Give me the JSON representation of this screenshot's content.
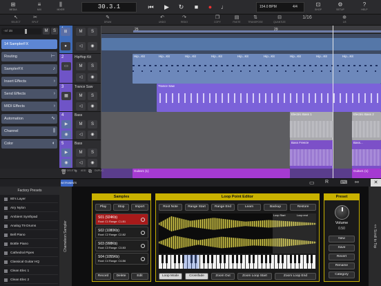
{
  "toolbar": {
    "media": "MEDIA",
    "mix": "MIX",
    "edit": "EDIT",
    "mixer": "MIXER",
    "position": "30.3.1",
    "bpm": "154.0 BPM",
    "sig": "4/4",
    "shop": "SHOP",
    "setup": "SETUP",
    "help": "HELP"
  },
  "subtoolbar": {
    "select": "SELECT",
    "split": "SPLIT",
    "draw": "DRAW",
    "undo": "UNDO",
    "redo": "REDO",
    "copy": "COPY",
    "paste": "PASTE",
    "quantize": "QUANTIZE",
    "transpose": "TRANSPOSE",
    "edit": "EDIT",
    "snap": "1/16",
    "zoom": "1/8"
  },
  "inspector": {
    "dryfx": "-Inf dB",
    "mute": "M",
    "solo": "S",
    "track": "14 SamplerFX",
    "items": [
      "Routing",
      "SamplerFX",
      "Insert Effects",
      "Send Effects",
      "MIDI Effects",
      "Automation",
      "Channel",
      "Color"
    ]
  },
  "ruler": [
    "25",
    "",
    "",
    "29",
    "",
    ""
  ],
  "tracks": [
    {
      "num": "1",
      "name": "",
      "color": "#6f54c7"
    },
    {
      "num": "2",
      "name": "HipHop Kit",
      "color": "#6f54c7"
    },
    {
      "num": "3",
      "name": "Trance Saw",
      "color": "#6f54c7"
    },
    {
      "num": "4",
      "name": "Bass",
      "color": "#6f54c7"
    },
    {
      "num": "5",
      "name": "Bass",
      "color": "#6f54c7"
    }
  ],
  "clips": {
    "hiphop": "Hip...Kit",
    "trance": "Trance Saw",
    "eb1": "Electric Bass 1",
    "eb2": "Electric Bass 2",
    "bf": "Bass Freeze",
    "bf2": "Bass...",
    "gt1": "Guitar1 (1)",
    "gt2": "Guitar1 (1)"
  },
  "bottomtools": {
    "delete": "DELETE",
    "add": "ADD",
    "duplicate": "DUPLIC."
  },
  "dock": {
    "instruments": "INSTRUMENTS"
  },
  "factory": {
    "title": "Factory Presets",
    "items": [
      "80's Layer",
      "Airy Nylon",
      "Ambient Synthpad",
      "Analog T9 Drums",
      "Bell Piano",
      "Bottle Piano",
      "Cathedral Pipes",
      "Classical Guitar HQ",
      "Clean Elec 1",
      "Clean Elec 2"
    ]
  },
  "sampler": {
    "side": "Chameleon Sampler",
    "samples_title": "Samples",
    "play": "Play",
    "stop": "Stop",
    "import": "Import",
    "list": [
      {
        "a": "S01 (924Kb)",
        "b": "Root: C1  Range: C1-B1"
      },
      {
        "a": "S02 (1080Kb)",
        "b": "Root: C2  Range: C2-B2"
      },
      {
        "a": "S03 (998Kb)",
        "b": "Root: C3  Range: C3-B3"
      },
      {
        "a": "S04 (1055Kb)",
        "b": "Root: C4  Range: C4-B6"
      }
    ],
    "record": "Record",
    "delete": "Delete",
    "edit": "Edit",
    "loop_title": "Loop Point Editor",
    "root": "Root Note",
    "rstart": "Range Start",
    "rend": "Range End",
    "learn": "Learn",
    "backup": "Backup",
    "restore": "Restore",
    "loopstart": "Loop Start",
    "loopend": "Loop end",
    "loopmode": "Loop Mode",
    "crossfade": "Crossfade",
    "zoomout": "Zoom Out",
    "zoomls": "Zoom Loop Start",
    "zoomle": "Zoom Loop End",
    "preset_title": "Preset",
    "volume": "Volume",
    "vol_val": "0.50",
    "new": "New",
    "save": "Save",
    "revert": "Revert",
    "rename": "Rename",
    "category": "Category",
    "scroll": "<< Scroll to Top"
  }
}
